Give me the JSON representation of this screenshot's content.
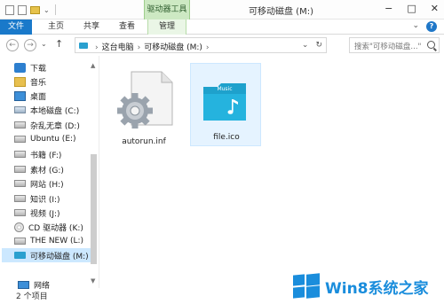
{
  "titlebar": {
    "contextual_tab": "驱动器工具",
    "window_title": "可移动磁盘 (M:)",
    "minimize": "−",
    "maximize": "□",
    "close": "✕"
  },
  "ribbon": {
    "tabs": [
      {
        "label": "文件"
      },
      {
        "label": "主页"
      },
      {
        "label": "共享"
      },
      {
        "label": "查看"
      },
      {
        "label": "管理"
      }
    ],
    "expand_glyph": "⌄",
    "help": "?"
  },
  "navigation": {
    "back": "←",
    "forward": "→",
    "history": "⌄",
    "up": "↑",
    "breadcrumb": [
      "这台电脑",
      "可移动磁盘 (M:)"
    ],
    "separator": "›",
    "dropdown": "⌄",
    "refresh": "↻"
  },
  "search": {
    "placeholder": "搜索\"可移动磁盘...\""
  },
  "sidebar": {
    "items": [
      {
        "label": "下载",
        "icon": "download-folder-icon"
      },
      {
        "label": "音乐",
        "icon": "music-folder-icon"
      },
      {
        "label": "桌面",
        "icon": "desktop-folder-icon"
      },
      {
        "label": "本地磁盘 (C:)",
        "icon": "system-drive-icon"
      },
      {
        "label": "杂乱无章 (D:)",
        "icon": "drive-icon"
      },
      {
        "label": "Ubuntu (E:)",
        "icon": "drive-icon"
      },
      {
        "label": "书籍 (F:)",
        "icon": "drive-icon"
      },
      {
        "label": "素材 (G:)",
        "icon": "drive-icon"
      },
      {
        "label": "网站 (H:)",
        "icon": "drive-icon"
      },
      {
        "label": "知识 (I:)",
        "icon": "drive-icon"
      },
      {
        "label": "视频 (J:)",
        "icon": "drive-icon"
      },
      {
        "label": "CD 驱动器 (K:)",
        "icon": "cd-drive-icon"
      },
      {
        "label": "THE NEW (L:)",
        "icon": "drive-icon"
      },
      {
        "label": "可移动磁盘 (M:)",
        "icon": "removable-drive-icon",
        "selected": true
      },
      {
        "label": "网络",
        "icon": "network-icon"
      }
    ],
    "scroll_up": "▲",
    "scroll_down": "▼"
  },
  "files": [
    {
      "name": "autorun.inf",
      "icon": "settings-file-icon"
    },
    {
      "name": "file.ico",
      "icon": "music-folder-file-icon",
      "icon_label": "Music",
      "selected": true
    }
  ],
  "status": {
    "item_count": "2 个项目"
  },
  "watermark": {
    "text": "Win8系统之家",
    "color": "#1a8ddc"
  },
  "colors": {
    "file_tab": "#1979ca",
    "context_tab": "#cde9c3",
    "selection": "#cce8ff",
    "drive_accent": "#2aa0cf"
  }
}
